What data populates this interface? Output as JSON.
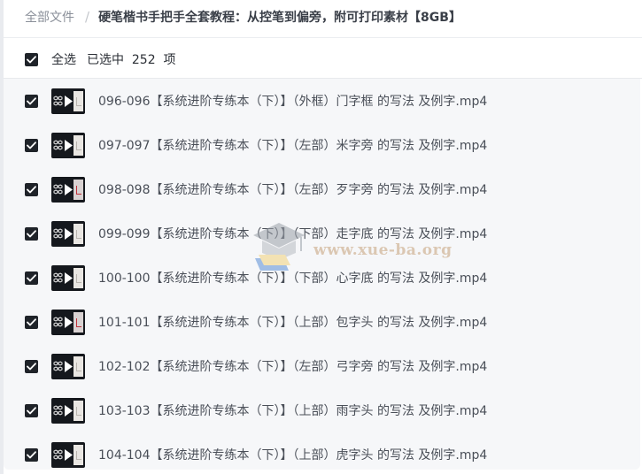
{
  "breadcrumb": {
    "root": "全部文件",
    "separator": "/",
    "current": "硬笔楷书手把手全套教程：从控笔到偏旁，附可打印素材【8GB】"
  },
  "selection": {
    "select_all_label": "全选",
    "selected_text": "已选中  252  项",
    "checked": true
  },
  "files": [
    {
      "name": "096-096【系统进阶专练本（下）】（外框）门字框 的写法 及例字.mp4",
      "checked": true
    },
    {
      "name": "097-097【系统进阶专练本（下）】（左部）米字旁 的写法 及例字.mp4",
      "checked": true
    },
    {
      "name": "098-098【系统进阶专练本（下）】（左部）歹字旁 的写法 及例字.mp4",
      "checked": true
    },
    {
      "name": "099-099【系统进阶专练本（下）】（下部）走字底 的写法 及例字.mp4",
      "checked": true
    },
    {
      "name": "100-100【系统进阶专练本（下）】（下部）心字底 的写法 及例字.mp4",
      "checked": true
    },
    {
      "name": "101-101【系统进阶专练本（下）】（上部）包字头 的写法 及例字.mp4",
      "checked": true
    },
    {
      "name": "102-102【系统进阶专练本（下）】（左部）弓字旁 的写法 及例字.mp4",
      "checked": true
    },
    {
      "name": "103-103【系统进阶专练本（下）】（上部）雨字头 的写法 及例字.mp4",
      "checked": true
    },
    {
      "name": "104-104【系统进阶专练本（下）】（上部）虎字头 的写法 及例字.mp4",
      "checked": true
    }
  ],
  "watermark": {
    "text": "www.xue-ba.org"
  },
  "icons": {
    "checkbox": "check-icon",
    "thumbnail": "video-thumbnail-icon",
    "watermark_logo": "graduation-cap-icon"
  },
  "colors": {
    "checkbox_fill": "#1f2329",
    "list_background": "#f6f7f9",
    "text_primary": "#2b2f36",
    "text_secondary": "#4a4f58",
    "breadcrumb_root": "#8a8f99",
    "watermark": "#c4a078"
  }
}
